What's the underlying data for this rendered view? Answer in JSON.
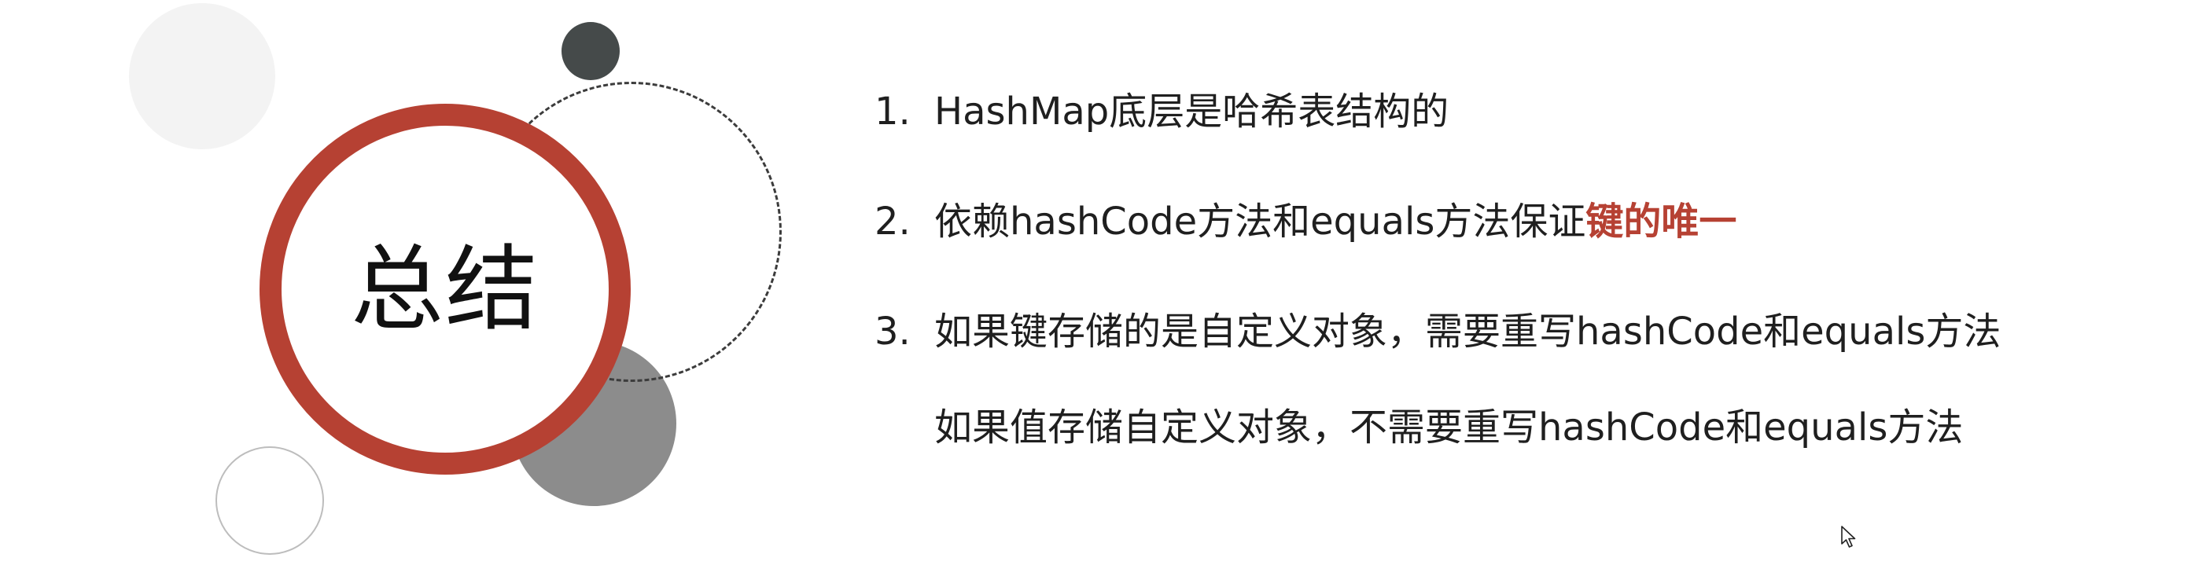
{
  "slide": {
    "title": "总结",
    "points": [
      {
        "number": "1.",
        "text": "HashMap底层是哈希表结构的"
      },
      {
        "number": "2.",
        "text": "依赖hashCode方法和equals方法保证",
        "highlight": "键的唯一"
      },
      {
        "number": "3.",
        "text": "如果键存储的是自定义对象，需要重写hashCode和equals方法"
      }
    ],
    "sub_point": "如果值存储自定义对象，不需要重写hashCode和equals方法"
  },
  "colors": {
    "accent": "#b64133",
    "text": "#1f1f1f",
    "dark_circle": "#454a4a",
    "mid_circle": "#8c8c8c",
    "light_circle": "#f3f3f3"
  },
  "icons": {
    "cursor": "mouse-pointer-icon"
  }
}
